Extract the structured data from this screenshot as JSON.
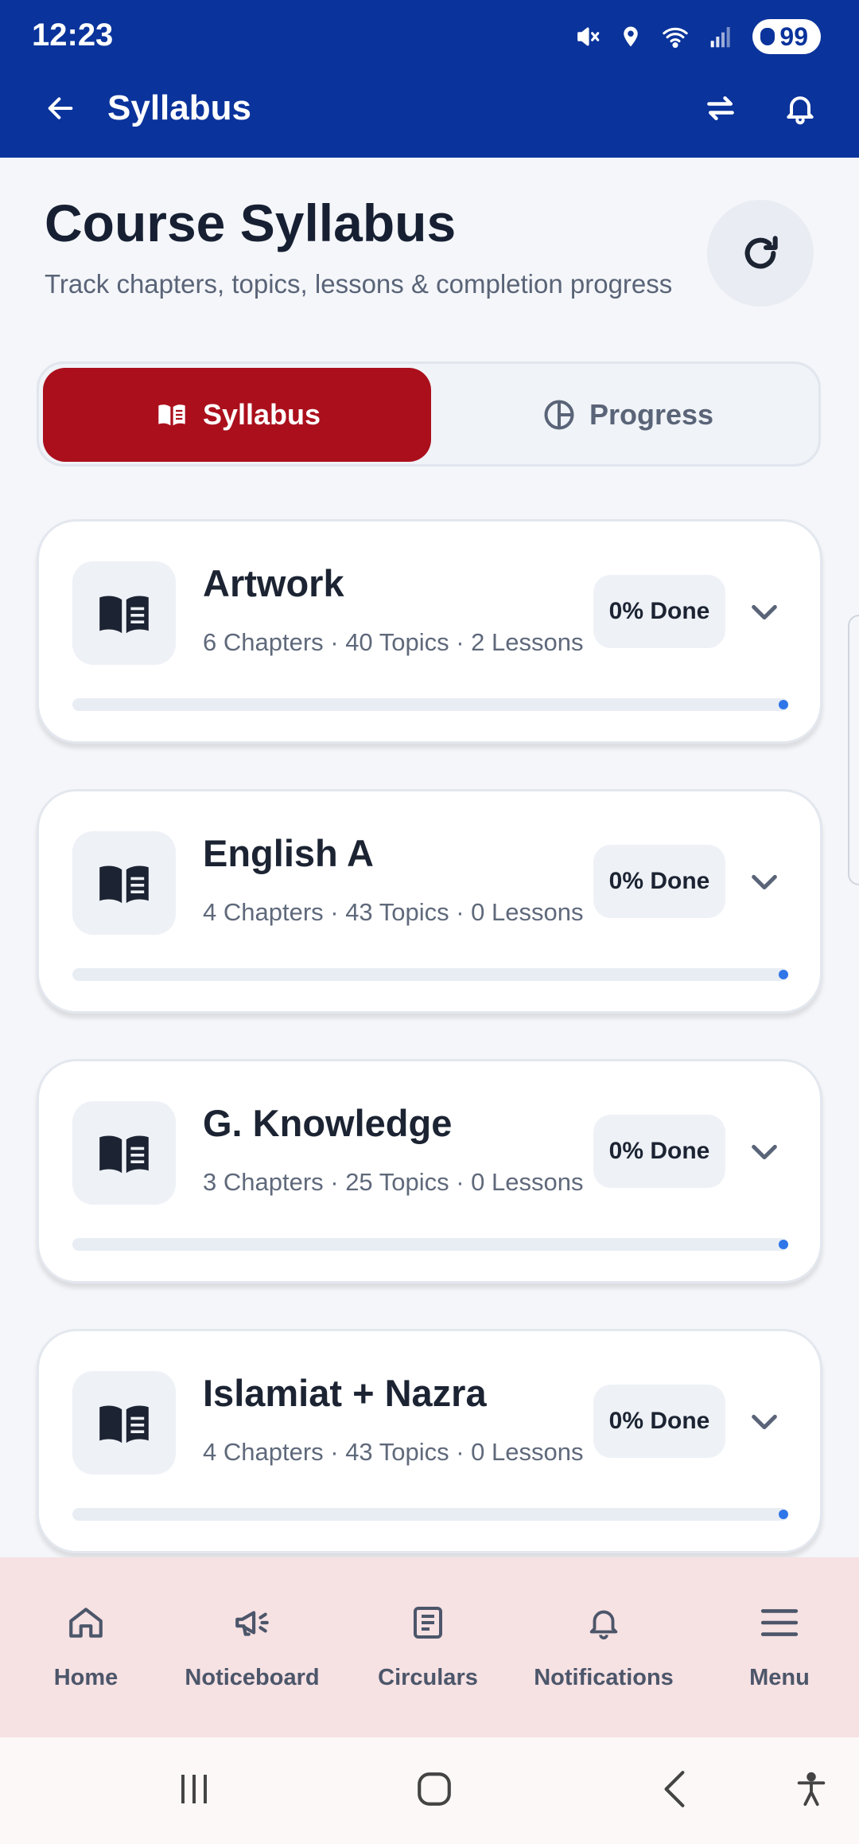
{
  "status_bar": {
    "time": "12:23",
    "battery": "99"
  },
  "app_bar": {
    "title": "Syllabus"
  },
  "header": {
    "title": "Course Syllabus",
    "subtitle": "Track chapters, topics, lessons & completion progress"
  },
  "tabs": [
    {
      "label": "Syllabus",
      "active": true
    },
    {
      "label": "Progress",
      "active": false
    }
  ],
  "courses": [
    {
      "name": "Artwork",
      "meta": "6 Chapters · 40 Topics · 2 Lessons",
      "done": "0% Done",
      "progress": 0
    },
    {
      "name": "English A",
      "meta": "4 Chapters · 43 Topics · 0 Lessons",
      "done": "0% Done",
      "progress": 0
    },
    {
      "name": "G. Knowledge",
      "meta": "3 Chapters · 25 Topics · 0 Lessons",
      "done": "0% Done",
      "progress": 0
    },
    {
      "name": "Islamiat + Nazra",
      "meta": "4 Chapters · 43 Topics · 0 Lessons",
      "done": "0% Done",
      "progress": 0
    }
  ],
  "bottom_nav": [
    {
      "label": "Home",
      "icon": "home-icon"
    },
    {
      "label": "Noticeboard",
      "icon": "megaphone-icon"
    },
    {
      "label": "Circulars",
      "icon": "document-icon"
    },
    {
      "label": "Notifications",
      "icon": "bell-icon"
    },
    {
      "label": "Menu",
      "icon": "hamburger-icon"
    }
  ],
  "colors": {
    "app_bar": "#0a339b",
    "active_tab": "#ab0f1c",
    "progress": "#2f76e8",
    "bottom_nav_bg": "#f6e1e3"
  }
}
